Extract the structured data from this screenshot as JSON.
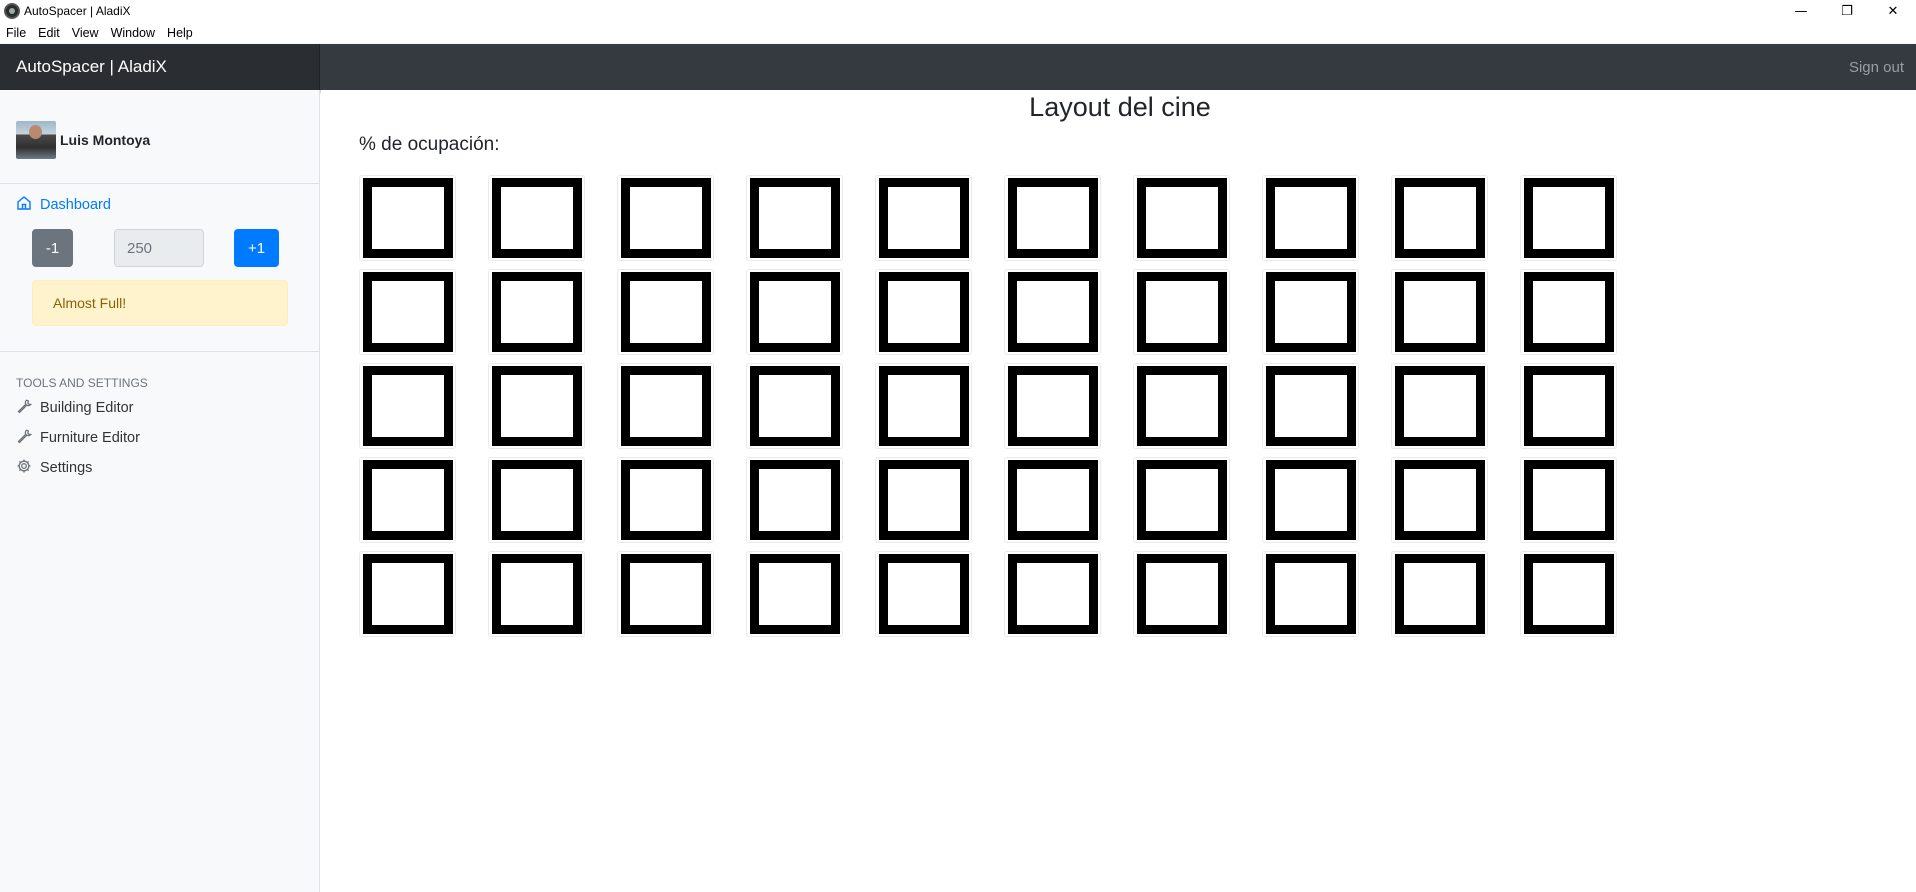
{
  "window": {
    "title": "AutoSpacer | AladiX",
    "controls": {
      "minimize": "—",
      "restore": "❐",
      "close": "✕"
    }
  },
  "menu": [
    "File",
    "Edit",
    "View",
    "Window",
    "Help"
  ],
  "navbar": {
    "brand": "AutoSpacer | AladiX",
    "sign_out": "Sign out"
  },
  "sidebar": {
    "user_name": "Luis Montoya",
    "dashboard_label": "Dashboard",
    "counter": {
      "minus_label": "-1",
      "value": "250",
      "plus_label": "+1"
    },
    "alert_text": "Almost Full!",
    "tools_heading": "TOOLS AND SETTINGS",
    "tools": [
      {
        "label": "Building Editor",
        "icon": "wrench-icon"
      },
      {
        "label": "Furniture Editor",
        "icon": "wrench-icon"
      },
      {
        "label": "Settings",
        "icon": "gear-icon"
      }
    ]
  },
  "main": {
    "title": "Layout del cine",
    "occupancy_label": "% de ocupación:",
    "seat_grid": {
      "rows": 5,
      "columns": 10
    }
  },
  "colors": {
    "navbar": "#343a40",
    "brand_bg": "#2a2e33",
    "primary": "#007bff",
    "secondary": "#6c757d",
    "alert_bg": "#fff3cd",
    "alert_text": "#856404",
    "seat_border": "#000000"
  }
}
